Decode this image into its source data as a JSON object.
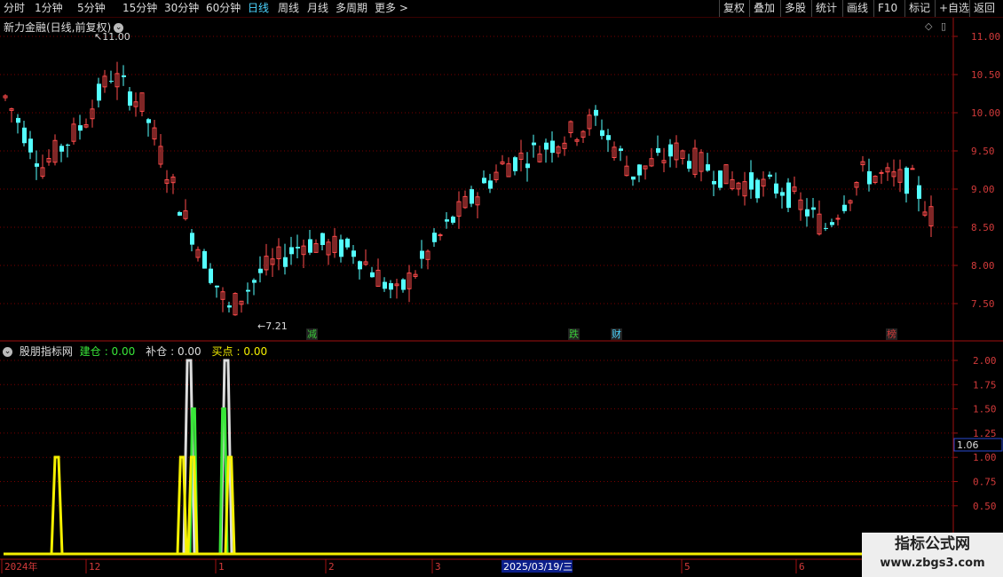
{
  "toolbar": {
    "left": [
      "分时",
      "1分钟",
      "5分钟",
      "15分钟",
      "30分钟",
      "60分钟",
      "日线",
      "周线",
      "月线",
      "多周期",
      "更多 >"
    ],
    "active": "日线",
    "right": [
      "复权",
      "叠加",
      "多股",
      "统计",
      "画线",
      "F10",
      "标记",
      "+自选",
      "返回"
    ]
  },
  "title": "新力金融(日线,前复权)",
  "price_axis": [
    "11.00",
    "10.50",
    "10.00",
    "9.50",
    "9.00",
    "8.50",
    "8.00",
    "7.50"
  ],
  "price_annotations": {
    "high": "11.00",
    "low": "7.21"
  },
  "event_markers": [
    {
      "label": "减",
      "color": "#39c839"
    },
    {
      "label": "跌",
      "color": "#39c839"
    },
    {
      "label": "财",
      "color": "#4bd4ff"
    },
    {
      "label": "榜",
      "color": "#d23a3a"
    }
  ],
  "indicator": {
    "name": "股朋指标网",
    "series": [
      {
        "name": "建仓",
        "value": "0.00",
        "color": "#39e639"
      },
      {
        "name": "补仓",
        "value": "0.00",
        "color": "#dddddd"
      },
      {
        "name": "买点",
        "value": "0.00",
        "color": "#f5f000"
      }
    ],
    "axis": [
      "2.00",
      "1.75",
      "1.50",
      "1.25",
      "1.00",
      "0.75",
      "0.50"
    ],
    "current_value": "1.06"
  },
  "time_axis": {
    "labels": [
      "2024年",
      "12",
      "1",
      "2",
      "3",
      "5",
      "6"
    ],
    "cursor_date": "2025/03/19/三"
  },
  "watermark": {
    "line1": "指标公式网",
    "line2": "www.zbgs3.com"
  },
  "colors": {
    "up": "#ff4b4b",
    "down": "#54ffff",
    "grid": "#7a0000",
    "border": "#a01010"
  }
}
